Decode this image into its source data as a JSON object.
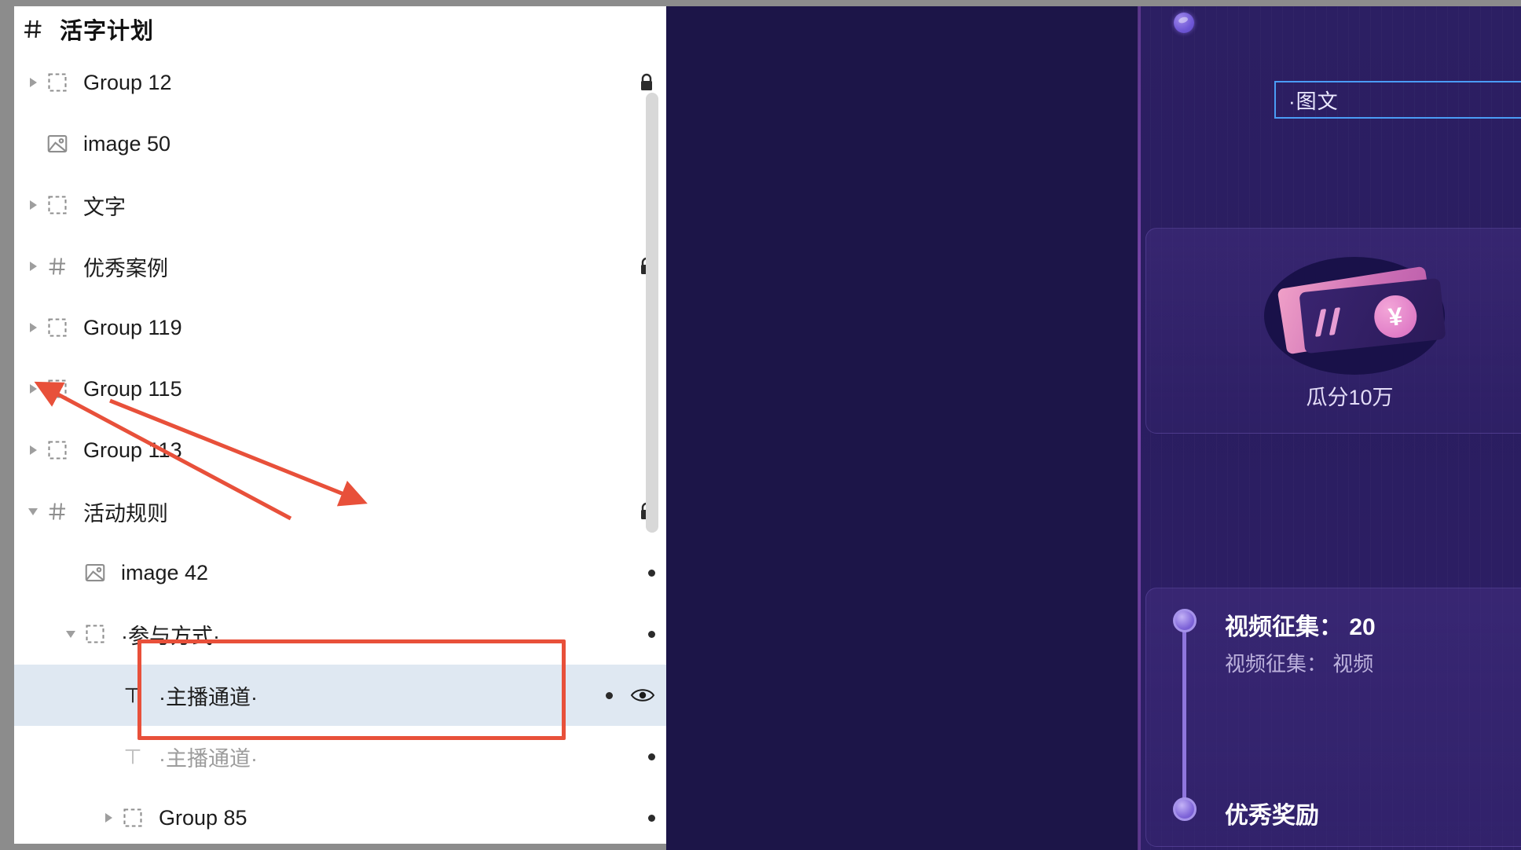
{
  "panel": {
    "title": "活字计划",
    "title_icon": "hash-icon",
    "rows": [
      {
        "label": "Group 12",
        "icon": "group-icon",
        "twisty": "right",
        "indent": 1,
        "locked": true,
        "dot": false,
        "eye": false,
        "dim": false,
        "selected": false
      },
      {
        "label": "image 50",
        "icon": "image-icon",
        "twisty": "none",
        "indent": 1,
        "locked": false,
        "dot": false,
        "eye": false,
        "dim": false,
        "selected": false
      },
      {
        "label": "文字",
        "icon": "group-icon",
        "twisty": "right",
        "indent": 1,
        "locked": false,
        "dot": false,
        "eye": false,
        "dim": false,
        "selected": false
      },
      {
        "label": "优秀案例",
        "icon": "hash-icon",
        "twisty": "right",
        "indent": 1,
        "locked": true,
        "dot": false,
        "eye": false,
        "dim": false,
        "selected": false
      },
      {
        "label": "Group 119",
        "icon": "group-icon",
        "twisty": "right",
        "indent": 1,
        "locked": false,
        "dot": false,
        "eye": false,
        "dim": false,
        "selected": false
      },
      {
        "label": "Group 115",
        "icon": "group-icon",
        "twisty": "right",
        "indent": 1,
        "locked": false,
        "dot": false,
        "eye": false,
        "dim": false,
        "selected": false
      },
      {
        "label": "Group 113",
        "icon": "group-icon",
        "twisty": "right",
        "indent": 1,
        "locked": false,
        "dot": false,
        "eye": false,
        "dim": false,
        "selected": false
      },
      {
        "label": "活动规则",
        "icon": "hash-icon",
        "twisty": "down",
        "indent": 1,
        "locked": true,
        "dot": false,
        "eye": false,
        "dim": false,
        "selected": false
      },
      {
        "label": "image 42",
        "icon": "image-icon",
        "twisty": "none",
        "indent": 2,
        "locked": false,
        "dot": true,
        "eye": false,
        "dim": false,
        "selected": false
      },
      {
        "label": "·参与方式·",
        "icon": "group-icon",
        "twisty": "down",
        "indent": 2,
        "locked": false,
        "dot": true,
        "eye": false,
        "dim": false,
        "selected": false
      },
      {
        "label": "·主播通道·",
        "icon": "text-icon",
        "twisty": "none",
        "indent": 3,
        "locked": false,
        "dot": true,
        "eye": true,
        "dim": false,
        "selected": true
      },
      {
        "label": "·主播通道·",
        "icon": "text-icon",
        "twisty": "none",
        "indent": 3,
        "locked": false,
        "dot": true,
        "eye": false,
        "dim": true,
        "selected": false
      },
      {
        "label": "Group 85",
        "icon": "group-icon",
        "twisty": "right",
        "indent": 3,
        "locked": false,
        "dot": true,
        "eye": false,
        "dim": false,
        "selected": false
      }
    ]
  },
  "canvas": {
    "text_element": "·图文",
    "card_caption": "瓜分10万",
    "ticket_symbol": "¥",
    "timeline": {
      "title": "视频征集： 20",
      "subtitle": "视频征集： 视频",
      "next_title": "优秀奖励"
    },
    "orb": "purple-orb"
  },
  "annotation": {
    "highlight_color": "#e8503a",
    "arrow_color": "#e8503a"
  }
}
